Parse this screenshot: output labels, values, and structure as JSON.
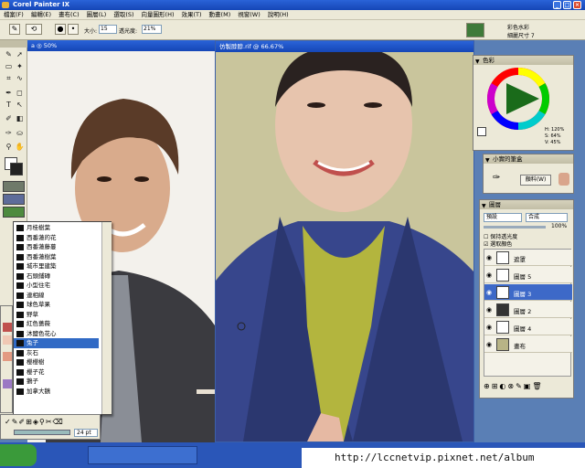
{
  "window": {
    "title": "Corel Painter IX"
  },
  "menu": [
    "檔案(F)",
    "編輯(E)",
    "畫布(C)",
    "圖層(L)",
    "選取(S)",
    "向量圖形(H)",
    "效果(T)",
    "動畫(M)",
    "視窗(W)",
    "說明(H)"
  ],
  "propbar": {
    "size_label": "大小:",
    "size_value": "15",
    "opacity_label": "透光度:",
    "opacity_value": "21%",
    "brush_title": "彩色水彩",
    "brush_sub": "細麗尺寸 7"
  },
  "doc1": {
    "title": "a ◎ 50%"
  },
  "doc2": {
    "title": "仿製脖脖.rif @ 66.67%"
  },
  "color_panel": {
    "title": "色彩",
    "h": "H: 120%",
    "s": "S: 64%",
    "v": "V: 45%"
  },
  "mixer_panel": {
    "title": "小實的筆盒",
    "button": "顏料(W)"
  },
  "layers_panel": {
    "title": "圖層",
    "mode": "預設",
    "composite": "合成",
    "opacity": "100%",
    "check1": "保持透光度",
    "check2": "選取顏色",
    "layers": [
      {
        "name": "遮罩",
        "selected": false
      },
      {
        "name": "圖層 5",
        "selected": false
      },
      {
        "name": "圖層 3",
        "selected": true
      },
      {
        "name": "圖層 2",
        "selected": false
      },
      {
        "name": "圖層 4",
        "selected": false
      },
      {
        "name": "畫布",
        "selected": false
      }
    ]
  },
  "dropdown": {
    "items": [
      "月桂樹葉",
      "西番蓮的花",
      "西番蓮藤蔓",
      "西番蓮樹葉",
      "城市里建築",
      "石頭鋪磚",
      "小型住宅",
      "連相線",
      "球色草果",
      "野草",
      "紅色薔薇",
      "沐鹽色花心",
      "兔子",
      "灰石",
      "櫻櫻樹",
      "櫻子花",
      "鵝子",
      "加拿大鵝"
    ],
    "selected_index": 12
  },
  "bottom_palette": {
    "size": "24 pt"
  },
  "url": "http://lccnetvip.pixnet.net/album",
  "colors": {
    "titlebar": "#1546b6",
    "chrome": "#ece9d8",
    "selection": "#316ac5",
    "jacket": "#3a4a8f",
    "tie": "#b0b33c"
  }
}
